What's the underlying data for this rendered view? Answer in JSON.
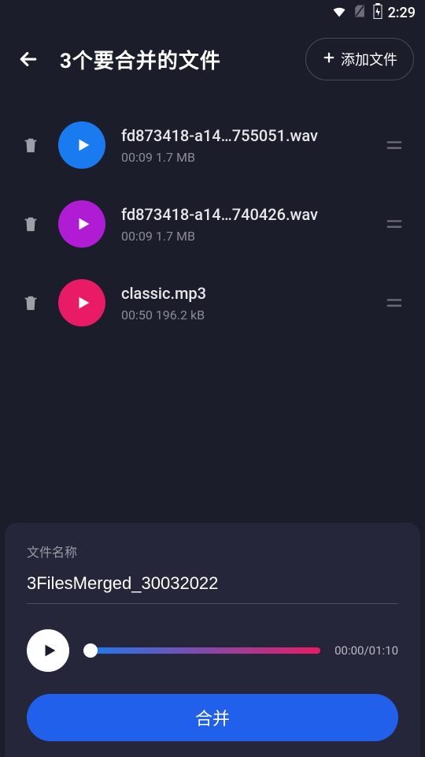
{
  "status_bar": {
    "time": "2:29"
  },
  "header": {
    "title": "3个要合并的文件",
    "add_file": "添加文件"
  },
  "files": [
    {
      "name": "fd873418-a14…755051.wav",
      "duration": "00:09",
      "size": "1.7 MB",
      "play_class": "play-blue"
    },
    {
      "name": "fd873418-a14…740426.wav",
      "duration": "00:09",
      "size": "1.7 MB",
      "play_class": "play-purple"
    },
    {
      "name": "classic.mp3",
      "duration": "00:50",
      "size": "196.2 kB",
      "play_class": "play-magenta"
    }
  ],
  "output": {
    "label": "文件名称",
    "filename": "3FilesMerged_30032022",
    "time_current": "00:00",
    "time_total": "01:10",
    "progress_percent": 3
  },
  "actions": {
    "merge": "合并"
  }
}
